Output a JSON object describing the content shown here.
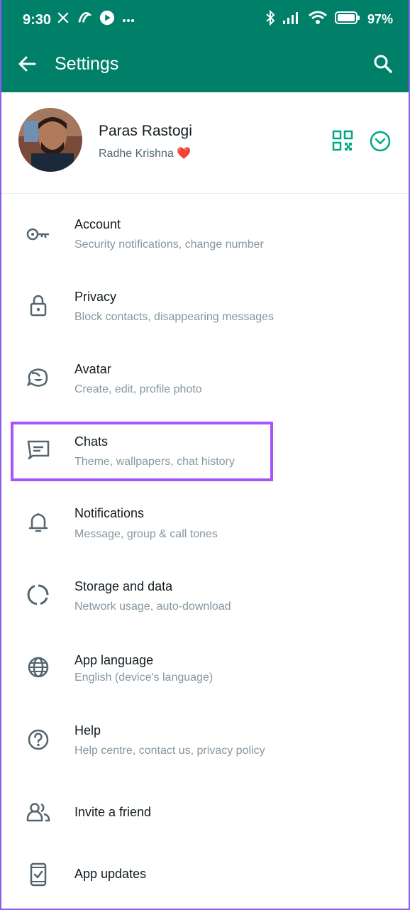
{
  "status_bar": {
    "time": "9:30",
    "battery": "97",
    "icons_left": [
      "x-icon",
      "loop-icon",
      "play-icon",
      "more-dots-icon"
    ],
    "icons_right": [
      "bluetooth-icon",
      "signal-icon",
      "wifi-icon",
      "battery-icon"
    ]
  },
  "header": {
    "title": "Settings",
    "color": "#008069"
  },
  "profile": {
    "name": "Paras Rastogi",
    "status": "Radhe Krishna ❤️"
  },
  "menu": [
    {
      "title": "Account",
      "subtitle": "Security notifications, change number",
      "icon": "key-icon"
    },
    {
      "title": "Privacy",
      "subtitle": "Block contacts, disappearing messages",
      "icon": "lock-icon"
    },
    {
      "title": "Avatar",
      "subtitle": "Create, edit, profile photo",
      "icon": "avatar-face-icon"
    },
    {
      "title": "Chats",
      "subtitle": "Theme, wallpapers, chat history",
      "icon": "chat-icon"
    },
    {
      "title": "Notifications",
      "subtitle": "Message, group & call tones",
      "icon": "bell-icon"
    },
    {
      "title": "Storage and data",
      "subtitle": "Network usage, auto-download",
      "icon": "storage-ring-icon"
    },
    {
      "title": "App language",
      "subtitle": "English (device's language)",
      "icon": "globe-icon"
    },
    {
      "title": "Help",
      "subtitle": "Help centre, contact us, privacy policy",
      "icon": "help-icon"
    },
    {
      "title": "Invite a friend",
      "icon": "people-icon"
    },
    {
      "title": "App updates",
      "icon": "phone-update-icon"
    }
  ],
  "highlight_color": "#a855f7",
  "accent_color": "#00a884"
}
